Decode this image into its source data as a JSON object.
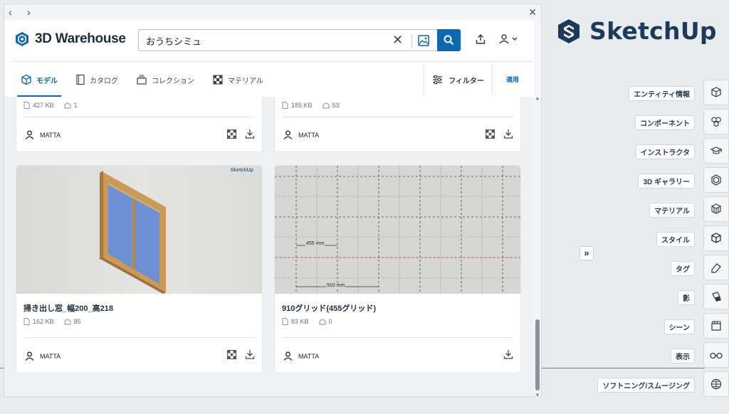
{
  "app": {
    "brand": "SketchUp"
  },
  "warehouse": {
    "brand": "3D Warehouse",
    "search_value": "おうちシミュ",
    "tabs": [
      {
        "label": "モデル",
        "active": true
      },
      {
        "label": "カタログ",
        "active": false
      },
      {
        "label": "コレクション",
        "active": false
      },
      {
        "label": "マテリアル",
        "active": false
      }
    ],
    "filter_label": "フィルター",
    "apply_label": "適用",
    "cards_top": [
      {
        "size": "427 KB",
        "likes": "1",
        "author": "MATTA",
        "has_material": true
      },
      {
        "size": "185 KB",
        "likes": "53",
        "author": "MATTA",
        "has_material": true
      }
    ],
    "cards": [
      {
        "title": "掃き出し窓_幅200_高218",
        "size": "162 KB",
        "likes": "85",
        "author": "MATTA",
        "has_material": true,
        "watermark": "SketchUp"
      },
      {
        "title": "910グリッド(455グリッド)",
        "size": "83 KB",
        "likes": "0",
        "author": "MATTA",
        "has_material": false,
        "dim1": "455 mm",
        "dim2": "910 mm"
      }
    ]
  },
  "tray": {
    "items": [
      {
        "label": "エンティティ情報",
        "icon": "entity-info-icon"
      },
      {
        "label": "コンポーネント",
        "icon": "components-icon"
      },
      {
        "label": "インストラクタ",
        "icon": "instructor-icon"
      },
      {
        "label": "3D ギャラリー",
        "icon": "gallery-icon"
      },
      {
        "label": "マテリアル",
        "icon": "materials-icon"
      },
      {
        "label": "スタイル",
        "icon": "styles-icon"
      },
      {
        "label": "タグ",
        "icon": "tags-icon"
      },
      {
        "label": "影",
        "icon": "shadows-icon"
      },
      {
        "label": "シーン",
        "icon": "scenes-icon"
      },
      {
        "label": "表示",
        "icon": "display-icon"
      },
      {
        "label": "ソフトニング/スムージング",
        "icon": "soften-icon"
      }
    ]
  },
  "colors": {
    "accent": "#0b68b0",
    "axis_red": "#d9534f",
    "sketchup_navy": "#1c3b5a"
  }
}
